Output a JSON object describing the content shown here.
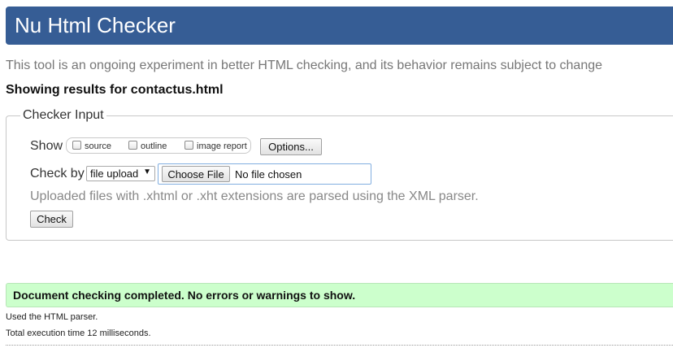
{
  "header": {
    "title": "Nu Html Checker",
    "background_color": "#365d95"
  },
  "tagline": "This tool is an ongoing experiment in better HTML checking, and its behavior remains subject to change",
  "results_heading": "Showing results for contactus.html",
  "checker_input": {
    "legend": "Checker Input",
    "show": {
      "label": "Show",
      "options": [
        {
          "label": "source",
          "checked": false
        },
        {
          "label": "outline",
          "checked": false
        },
        {
          "label": "image report",
          "checked": false
        }
      ],
      "options_button": "Options..."
    },
    "check_by": {
      "label": "Check by",
      "selected": "file upload",
      "choose_file_button": "Choose File",
      "file_status": "No file chosen"
    },
    "xml_note": "Uploaded files with .xhtml or .xht extensions are parsed using the XML parser.",
    "check_button": "Check"
  },
  "result": {
    "message": "Document checking completed. No errors or warnings to show.",
    "background_color": "#ccffcc",
    "parser_note": "Used the HTML parser.",
    "time_note": "Total execution time 12 milliseconds."
  }
}
